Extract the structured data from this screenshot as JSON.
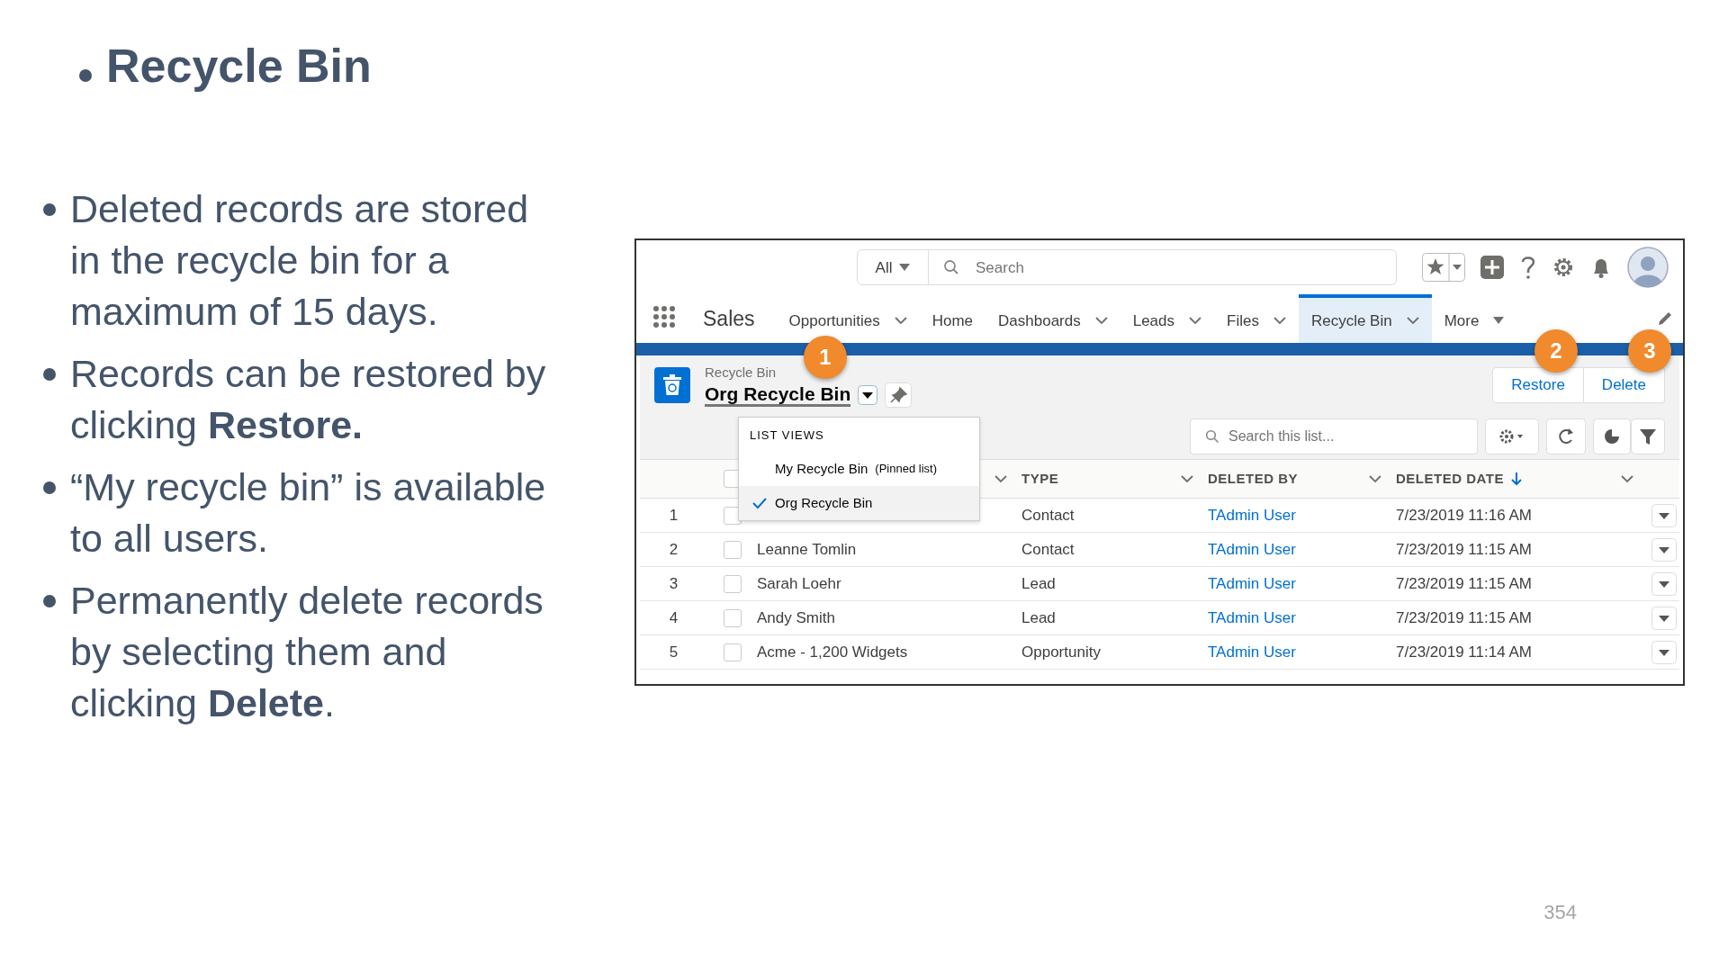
{
  "slide": {
    "title": "Recycle Bin",
    "bullets": [
      "Deleted records are stored in the recycle bin for a maximum of 15 days.",
      "Records can be restored by clicking **Restore.**",
      "“My recycle bin” is available to all users.",
      "Permanently delete records by selecting them and clicking **Delete**."
    ],
    "page_number": "354"
  },
  "app": {
    "scope": "All",
    "search_placeholder": "Search",
    "app_name": "Sales",
    "nav": [
      {
        "label": "Opportunities",
        "menu": true,
        "selected": false
      },
      {
        "label": "Home",
        "menu": false,
        "selected": false
      },
      {
        "label": "Dashboards",
        "menu": true,
        "selected": false
      },
      {
        "label": "Leads",
        "menu": true,
        "selected": false
      },
      {
        "label": "Files",
        "menu": true,
        "selected": false
      },
      {
        "label": "Recycle Bin",
        "menu": true,
        "selected": true
      }
    ],
    "more": "More",
    "header": {
      "object": "Recycle Bin",
      "title": "Org Recycle Bin"
    },
    "actions": [
      "Restore",
      "Delete"
    ],
    "list_search_placeholder": "Search this list...",
    "list_views": {
      "heading": "LIST VIEWS",
      "items": [
        {
          "label": "My Recycle Bin",
          "note": "(Pinned list)",
          "selected": false
        },
        {
          "label": "Org Recycle Bin",
          "selected": true
        }
      ]
    },
    "select_all": {
      "checked": false
    },
    "columns": [
      {
        "label": "TYPE",
        "sorted": false
      },
      {
        "label": "DELETED BY",
        "sorted": false
      },
      {
        "label": "DELETED DATE",
        "sorted": true
      }
    ],
    "rows": [
      {
        "number": "1",
        "checked": false,
        "type": "Contact",
        "deleted_by": "TAdmin User",
        "deleted_date": "7/23/2019 11:16 AM"
      },
      {
        "number": "2",
        "checked": false,
        "name": "Leanne Tomlin",
        "type": "Contact",
        "deleted_by": "TAdmin User",
        "deleted_date": "7/23/2019 11:15 AM"
      },
      {
        "number": "3",
        "checked": false,
        "name": "Sarah Loehr",
        "type": "Lead",
        "deleted_by": "TAdmin User",
        "deleted_date": "7/23/2019 11:15 AM"
      },
      {
        "number": "4",
        "checked": false,
        "name": "Andy Smith",
        "type": "Lead",
        "deleted_by": "TAdmin User",
        "deleted_date": "7/23/2019 11:15 AM"
      },
      {
        "number": "5",
        "checked": false,
        "name": "Acme - 1,200 Widgets",
        "type": "Opportunity",
        "deleted_by": "TAdmin User",
        "deleted_date": "7/23/2019 11:14 AM"
      }
    ],
    "callouts": [
      "1",
      "2",
      "3"
    ]
  }
}
